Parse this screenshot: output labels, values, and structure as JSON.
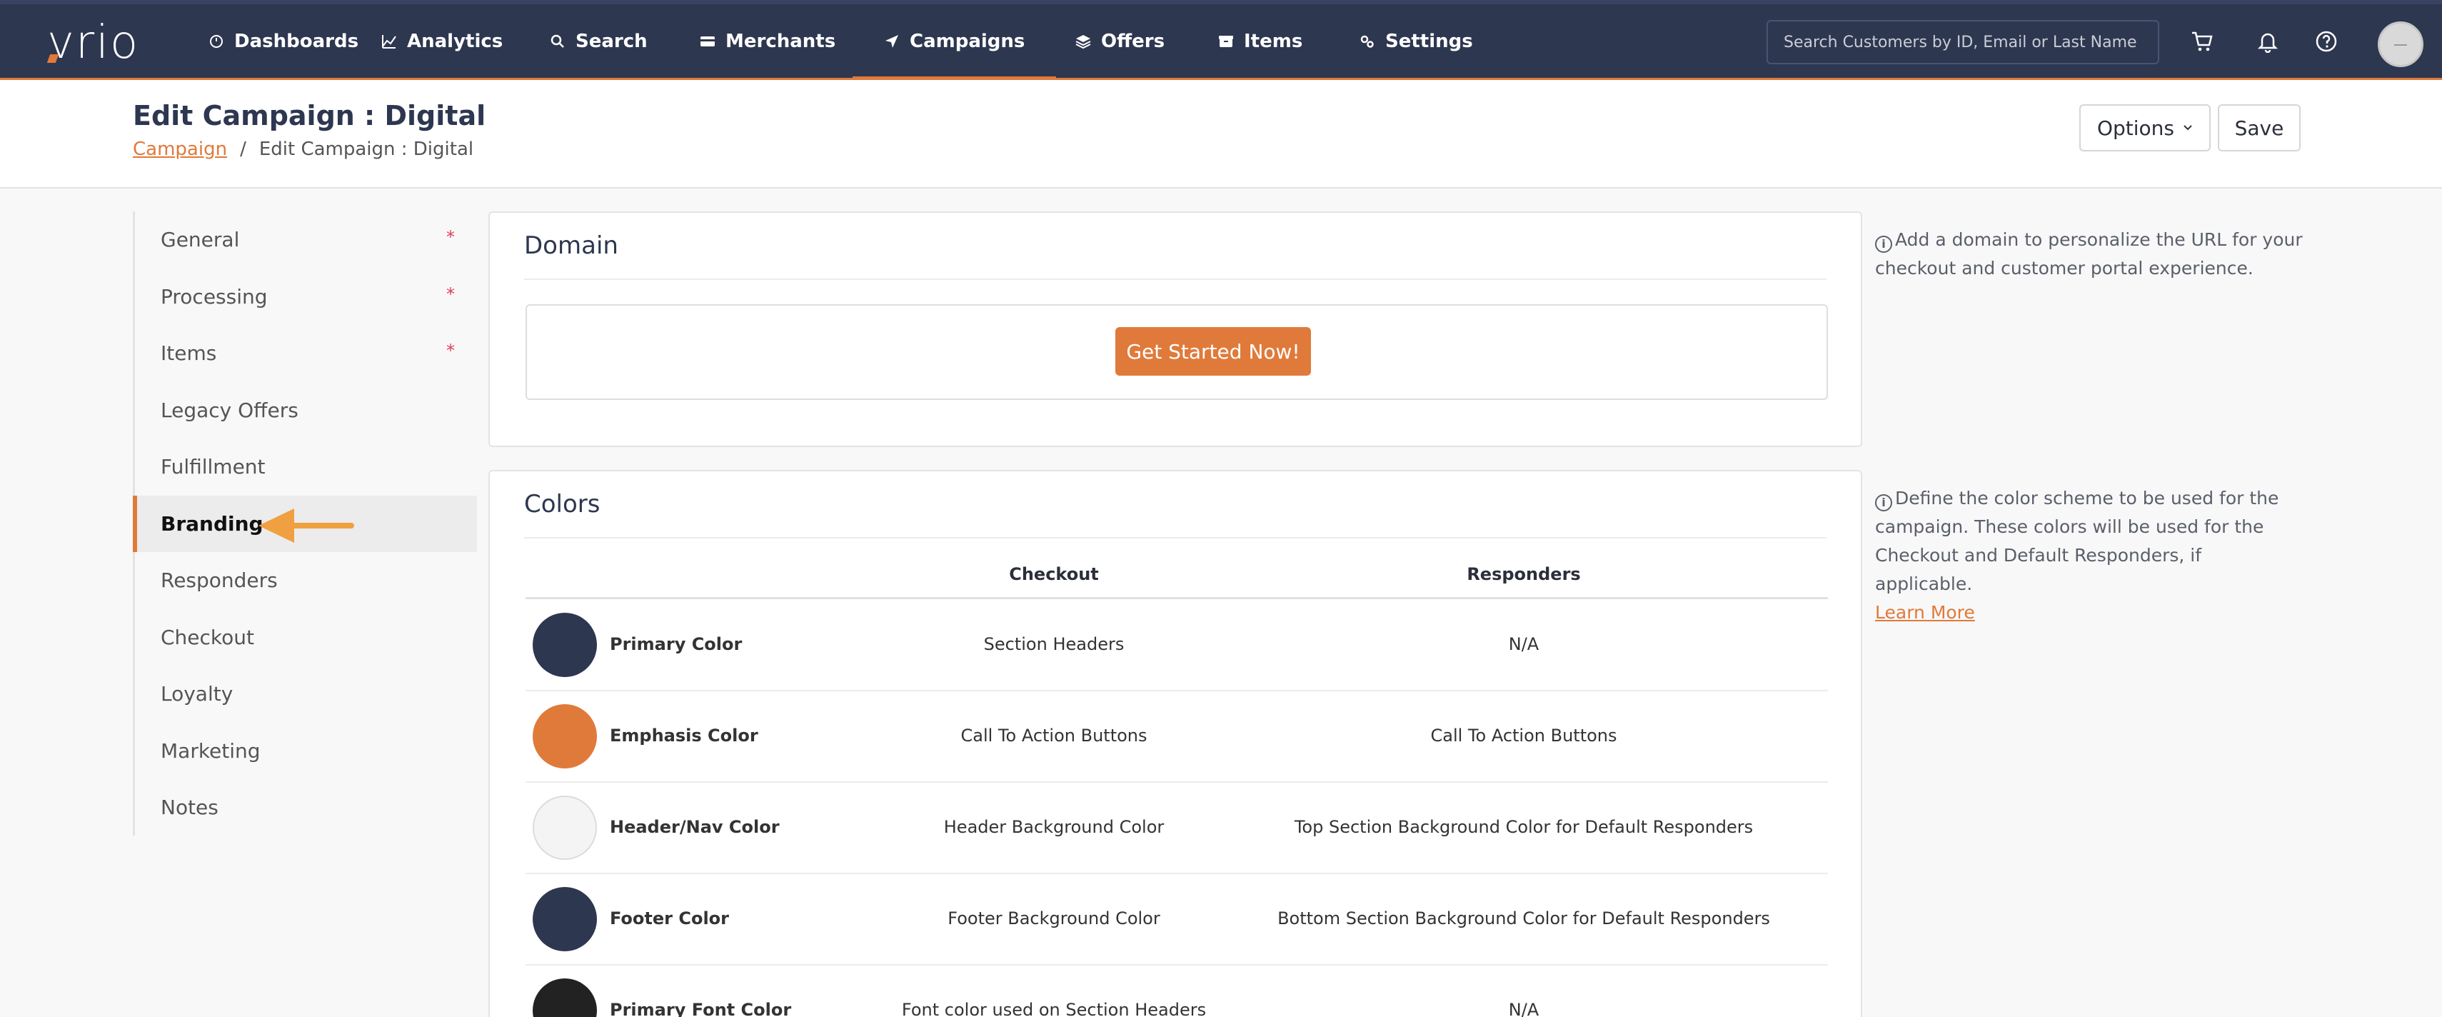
{
  "app": {
    "logo": "vrio"
  },
  "nav": {
    "items": [
      {
        "label": "Dashboards",
        "icon": "dashboard-icon"
      },
      {
        "label": "Analytics",
        "icon": "chart-icon"
      },
      {
        "label": "Search",
        "icon": "search-icon"
      },
      {
        "label": "Merchants",
        "icon": "card-icon"
      },
      {
        "label": "Campaigns",
        "icon": "send-icon",
        "active": true
      },
      {
        "label": "Offers",
        "icon": "layers-icon"
      },
      {
        "label": "Items",
        "icon": "box-icon"
      },
      {
        "label": "Settings",
        "icon": "gears-icon"
      }
    ],
    "search_placeholder": "Search Customers by ID, Email or Last Name",
    "accent": "#e07a3a",
    "background": "#2e3750"
  },
  "header": {
    "title": "Edit Campaign : Digital",
    "breadcrumb": {
      "link": "Campaign",
      "separator": "/",
      "current": "Edit Campaign : Digital"
    },
    "options_label": "Options",
    "save_label": "Save"
  },
  "sidebar": {
    "items": [
      {
        "label": "General",
        "required": "*"
      },
      {
        "label": "Processing",
        "required": "*"
      },
      {
        "label": "Items",
        "required": "*"
      },
      {
        "label": "Legacy Offers"
      },
      {
        "label": "Fulfillment"
      },
      {
        "label": "Branding",
        "active": true
      },
      {
        "label": "Responders"
      },
      {
        "label": "Checkout"
      },
      {
        "label": "Loyalty"
      },
      {
        "label": "Marketing"
      },
      {
        "label": "Notes"
      }
    ]
  },
  "domain": {
    "title": "Domain",
    "cta_label": "Get Started Now!",
    "help_text": "Add a domain to personalize the URL for your checkout and customer portal experience."
  },
  "colors": {
    "title": "Colors",
    "columns": {
      "checkout": "Checkout",
      "responders": "Responders"
    },
    "rows": [
      {
        "name": "Primary Color",
        "swatch": "#2e3750",
        "checkout": "Section Headers",
        "responders": "N/A"
      },
      {
        "name": "Emphasis Color",
        "swatch": "#e07a3a",
        "checkout": "Call To Action Buttons",
        "responders": "Call To Action Buttons"
      },
      {
        "name": "Header/Nav Color",
        "swatch": "#f4f4f4",
        "checkout": "Header Background Color",
        "responders": "Top Section Background Color for Default Responders"
      },
      {
        "name": "Footer Color",
        "swatch": "#2e3750",
        "checkout": "Footer Background Color",
        "responders": "Bottom Section Background Color for Default Responders"
      },
      {
        "name": "Primary Font Color",
        "swatch": "#222222",
        "checkout": "Font color used on Section Headers",
        "responders": "N/A"
      }
    ],
    "help_text": "Define the color scheme to be used for the campaign. These colors will be used for the Checkout and Default Responders, if applicable.",
    "help_link": "Learn More"
  }
}
